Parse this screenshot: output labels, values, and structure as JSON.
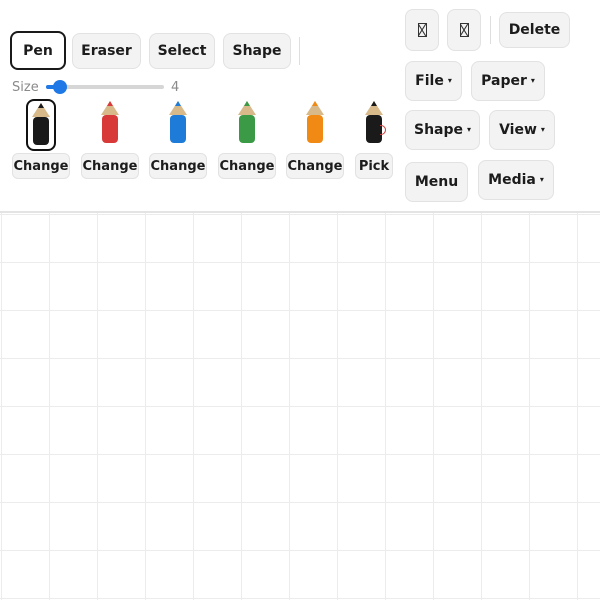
{
  "toolbar": {
    "tools": [
      {
        "label": "Pen",
        "active": true
      },
      {
        "label": "Eraser",
        "active": false
      },
      {
        "label": "Select",
        "active": false
      },
      {
        "label": "Shape",
        "active": false
      }
    ],
    "undo_icon": "missing-glyph-icon",
    "redo_icon": "missing-glyph-icon",
    "delete_label": "Delete",
    "menus": {
      "file": "File",
      "paper": "Paper",
      "shape": "Shape",
      "view": "View",
      "menu": "Menu",
      "media": "Media"
    },
    "dropdown_caret": "▾"
  },
  "size": {
    "label": "Size",
    "value": "4",
    "slider_fraction": 0.06
  },
  "pens": [
    {
      "color": "#1a1a1a",
      "selected": true,
      "action": "Change"
    },
    {
      "color": "#d83a3a",
      "selected": false,
      "action": "Change"
    },
    {
      "color": "#1e7cd8",
      "selected": false,
      "action": "Change"
    },
    {
      "color": "#3a9a46",
      "selected": false,
      "action": "Change"
    },
    {
      "color": "#f08a14",
      "selected": false,
      "action": "Change"
    },
    {
      "color": "#1a1a1a",
      "selected": false,
      "action": "Pick"
    }
  ],
  "colors": {
    "accent": "#1e78e6",
    "pencil_wood": "#d8b98a",
    "grid_line": "#ececec"
  }
}
